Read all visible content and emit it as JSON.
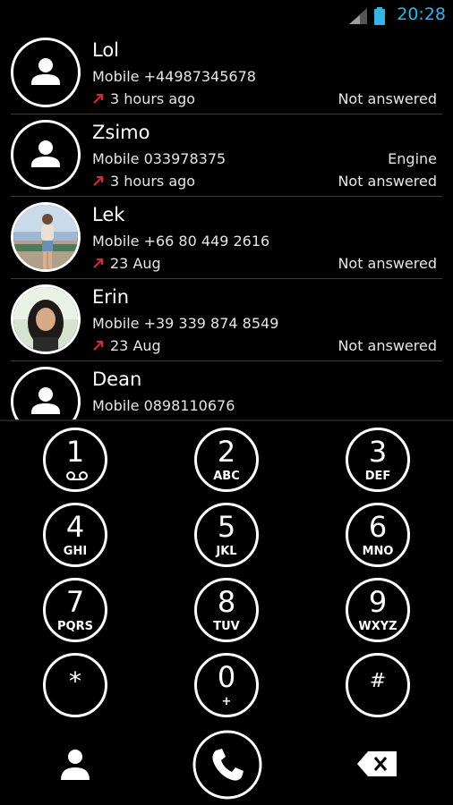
{
  "status_bar": {
    "time": "20:28",
    "accent": "#33b5e5"
  },
  "colors": {
    "missed_arrow": "#d32f2f",
    "background": "#000000",
    "separator": "#3a3a3a"
  },
  "calls": [
    {
      "name": "Lol",
      "number": "Mobile +44987345678",
      "label": "",
      "when": "3 hours ago",
      "status": "Not answered",
      "avatar": "default-person-icon"
    },
    {
      "name": "Zsimo",
      "number": "Mobile 033978375",
      "label": "Engine",
      "when": "3 hours ago",
      "status": "Not answered",
      "avatar": "default-person-icon"
    },
    {
      "name": "Lek",
      "number": "Mobile +66 80 449 2616",
      "label": "",
      "when": "23 Aug",
      "status": "Not answered",
      "avatar": "photo-lek"
    },
    {
      "name": "Erin",
      "number": "Mobile +39 339 874 8549",
      "label": "",
      "when": "23 Aug",
      "status": "Not answered",
      "avatar": "photo-erin"
    },
    {
      "name": "Dean",
      "number": "Mobile 0898110676",
      "label": "",
      "when": "",
      "status": "",
      "avatar": "default-person-icon"
    }
  ],
  "keypad": [
    {
      "digit": "1",
      "letters": "",
      "extra": "voicemail-icon"
    },
    {
      "digit": "2",
      "letters": "ABC"
    },
    {
      "digit": "3",
      "letters": "DEF"
    },
    {
      "digit": "4",
      "letters": "GHI"
    },
    {
      "digit": "5",
      "letters": "JKL"
    },
    {
      "digit": "6",
      "letters": "MNO"
    },
    {
      "digit": "7",
      "letters": "PQRS"
    },
    {
      "digit": "8",
      "letters": "TUV"
    },
    {
      "digit": "9",
      "letters": "WXYZ"
    },
    {
      "digit": "*",
      "letters": ""
    },
    {
      "digit": "0",
      "letters": "+"
    },
    {
      "digit": "#",
      "letters": ""
    }
  ],
  "actions": {
    "contacts": "person-icon",
    "call": "phone-icon",
    "delete": "backspace-icon"
  }
}
